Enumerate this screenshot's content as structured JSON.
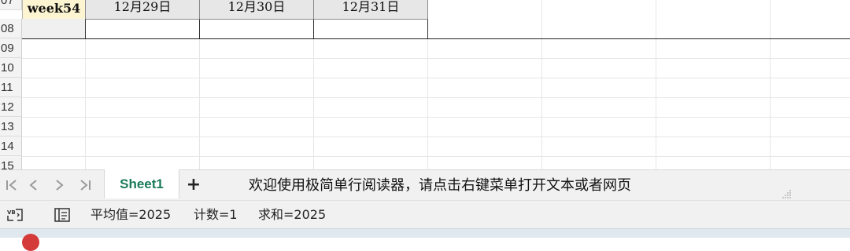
{
  "sheet": {
    "row_numbers": [
      "07",
      "08",
      "09",
      "10",
      "11",
      "12",
      "13",
      "14",
      "15"
    ],
    "header_row": {
      "week_label": "week54",
      "dates": [
        "12月29日",
        "12月30日",
        "12月31日"
      ]
    }
  },
  "tabbar": {
    "nav_first": "|<",
    "nav_prev": "<",
    "nav_next": ">",
    "nav_last": ">|",
    "active_sheet": "Sheet1",
    "add_sheet": "+",
    "marquee_text": "欢迎使用极简单行阅读器，请点击右键菜单打开文本或者网页"
  },
  "statusbar": {
    "macro_icon": "vba-macro-icon",
    "layout_icon": "page-layout-icon",
    "average": "平均值=2025",
    "count": "计数=1",
    "sum": "求和=2025"
  },
  "colors": {
    "week_cell_bg": "#fdf5d2",
    "date_header_bg": "#e7e7e7",
    "sheet_tab_text": "#1a7a5a",
    "taskbar_icon": "#d43a3a"
  }
}
